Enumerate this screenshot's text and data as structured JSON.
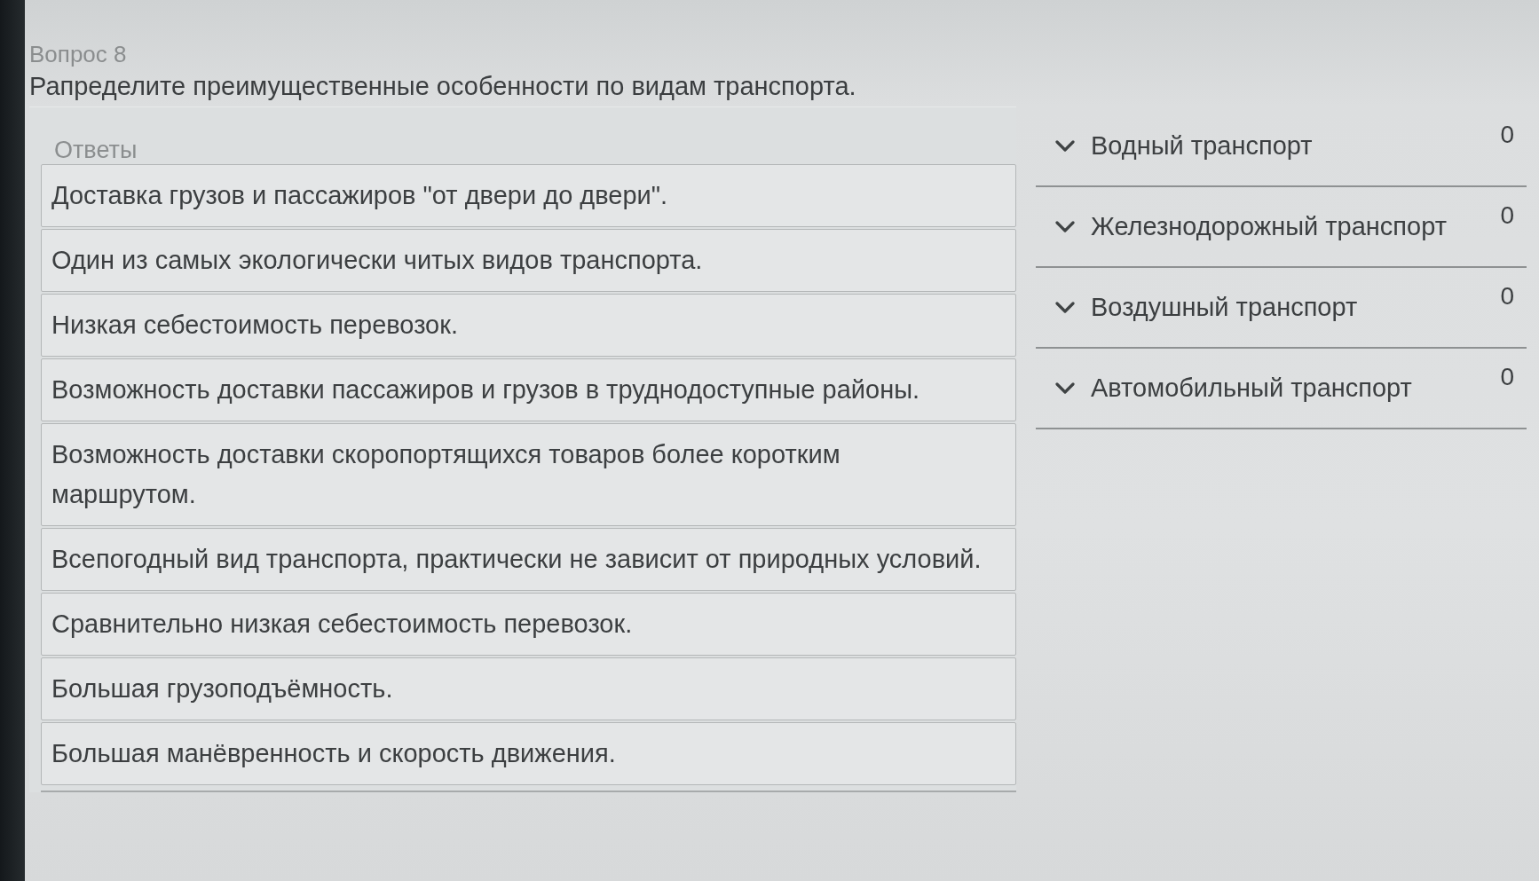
{
  "question": {
    "number_label": "Вопрос 8",
    "text": "Рапределите преимущественные особенности по видам транспорта."
  },
  "answers": {
    "heading": "Ответы",
    "items": [
      "Доставка грузов и пассажиров \"от двери до двери\".",
      "Один из самых экологически читых видов транспорта.",
      "Низкая себестоимость перевозок.",
      "Возможность доставки пассажиров и грузов в труднодоступные районы.",
      "Возможность доставки скоропортящихся товаров более коротким маршрутом.",
      "Всепогодный вид транспорта, практически не зависит от природных условий.",
      "Сравнительно низкая себестоимость перевозок.",
      "Большая грузоподъёмность.",
      "Большая манёвренность и скорость движения."
    ]
  },
  "categories": [
    {
      "title": "Водный транспорт",
      "count": "0",
      "expanded": false
    },
    {
      "title": "Железнодорожный транспорт",
      "count": "0",
      "expanded": false
    },
    {
      "title": "Воздушный транспорт",
      "count": "0",
      "expanded": false
    },
    {
      "title": "Автомобильный транспорт",
      "count": "0",
      "expanded": false
    }
  ]
}
